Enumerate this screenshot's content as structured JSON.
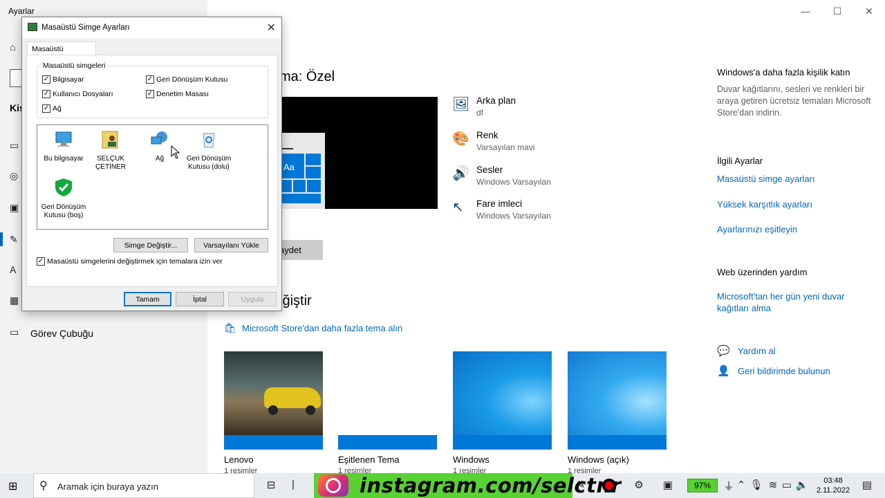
{
  "app": {
    "title": "Ayarlar"
  },
  "window_controls": {
    "minimize": "—",
    "maximize": "☐",
    "close": "✕"
  },
  "sidebar": {
    "partial_header": "Kiş",
    "taskbar_item": "Görev Çubuğu"
  },
  "main": {
    "theme_heading": "ma: Özel",
    "preview_aa": "Aa",
    "properties": [
      {
        "title": "Arka plan",
        "value": "df",
        "icon": "image-icon"
      },
      {
        "title": "Renk",
        "value": "Varsayılan mavi",
        "icon": "palette-icon"
      },
      {
        "title": "Sesler",
        "value": "Windows Varsayılan",
        "icon": "speaker-icon"
      },
      {
        "title": "Fare imleci",
        "value": "Windows Varsayılan",
        "icon": "cursor-icon"
      }
    ],
    "save_button": "aydet",
    "change_heading": "iğiştir",
    "store_link": "Microsoft Store'dan daha fazla tema alın",
    "themes": [
      {
        "name": "Lenovo",
        "count": "1 resimler"
      },
      {
        "name": "Eşitlenen Tema",
        "count": "1 resimler"
      },
      {
        "name": "Windows",
        "count": "1 resimler"
      },
      {
        "name": "Windows (açık)",
        "count": "1 resimler"
      }
    ]
  },
  "right_panel": {
    "promo_heading": "Windows'a daha fazla kişilik katın",
    "promo_text": "Duvar kağıtlarını, sesleri ve renkleri bir araya getiren ücretsiz temaları Microsoft Store'dan indirin.",
    "related_heading": "İlgili Ayarlar",
    "related_links": [
      "Masaüstü simge ayarları",
      "Yüksek karşıtlık ayarları",
      "Ayarlarınızı eşitleyin"
    ],
    "web_heading": "Web üzerinden yardım",
    "web_link": "Microsoft'tan her gün yeni duvar kağıtları alma",
    "help": "Yardım al",
    "feedback": "Geri bildirimde bulunun"
  },
  "dialog": {
    "title": "Masaüstü Simge Ayarları",
    "tab": "Masaüstü Simgeleri",
    "group_label": "Masaüstü simgeleri",
    "checkboxes": [
      {
        "label": "Bilgisayar",
        "checked": true
      },
      {
        "label": "Geri Dönüşüm Kutusu",
        "checked": true
      },
      {
        "label": "Kullanıcı Dosyaları",
        "checked": true
      },
      {
        "label": "Denetim Masası",
        "checked": true
      },
      {
        "label": "Ağ",
        "checked": true
      }
    ],
    "icons": [
      {
        "line1": "Bu bilgisayar",
        "line2": ""
      },
      {
        "line1": "SELÇUK",
        "line2": "ÇETİNER"
      },
      {
        "line1": "Ağ",
        "line2": ""
      },
      {
        "line1": "Geri Dönüşüm",
        "line2": "Kutusu (dolu)"
      },
      {
        "line1": "Geri Dönüşüm",
        "line2": "Kutusu (boş)"
      }
    ],
    "change_icon": "Simge Değiştir...",
    "restore_default": "Varsayılanı Yükle",
    "allow_themes": "Masaüstü simgelerini değiştirmek için temalara izin ver",
    "ok": "Tamam",
    "cancel": "İptal",
    "apply": "Uygula"
  },
  "taskbar": {
    "search_placeholder": "Aramak için buraya yazın",
    "instagram": "instagram.com/selctnr",
    "battery": "97%",
    "time": "03:48",
    "date": "2.11.2022"
  },
  "colors": {
    "accent": "#0067c0",
    "tile": "#0078d7",
    "insta_green": "#58d233"
  }
}
